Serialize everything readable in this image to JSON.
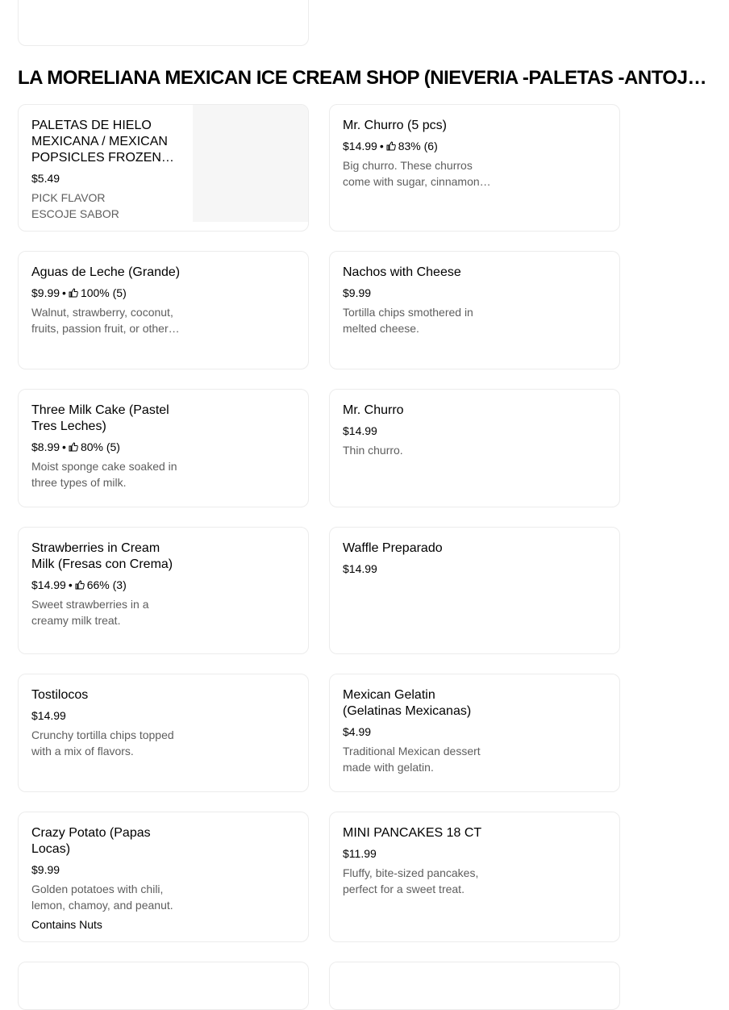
{
  "section": {
    "title": "LA MORELIANA MEXICAN ICE CREAM SHOP (NIEVERIA -PALETAS -ANTOJOS -MEXICAN SNACKS)"
  },
  "items": [
    {
      "name": "PALETAS DE HIELO MEXICANA / MEXICAN POPSICLES FROZEN( PALETAS)",
      "price": "$5.49",
      "description_lines": [
        "PICK FLAVOR",
        "ESCOJE SABOR"
      ],
      "has_image": true
    },
    {
      "name": "Mr. Churro (5 pcs)",
      "price": "$14.99",
      "rating": "83% (6)",
      "description": "Big churro. These churros come with sugar, cinnamon and your choice of filling."
    },
    {
      "name": "Aguas de Leche (Grande)",
      "price": "$9.99",
      "rating": "100% (5)",
      "description": "Walnut, strawberry, coconut, fruits, passion fruit, or other flavors available."
    },
    {
      "name": "Nachos with Cheese",
      "price": "$9.99",
      "description": "Tortilla chips smothered in melted cheese."
    },
    {
      "name": "Three Milk Cake (Pastel Tres Leches)",
      "price": "$8.99",
      "rating": "80% (5)",
      "description": "Moist sponge cake soaked in three types of milk."
    },
    {
      "name": "Mr. Churro",
      "price": "$14.99",
      "description": "Thin churro."
    },
    {
      "name": "Strawberries in Cream Milk (Fresas con Crema)",
      "price": "$14.99",
      "rating": "66% (3)",
      "description": "Sweet strawberries in a creamy milk treat."
    },
    {
      "name": "Waffle Preparado",
      "price": "$14.99"
    },
    {
      "name": "Tostilocos",
      "price": "$14.99",
      "description": "Crunchy tortilla chips topped with a mix of flavors."
    },
    {
      "name": "Mexican Gelatin (Gelatinas Mexicanas)",
      "price": "$4.99",
      "description": "Traditional Mexican dessert made with gelatin."
    },
    {
      "name": "Crazy Potato (Papas Locas)",
      "price": "$9.99",
      "description": "Golden potatoes with chili, lemon, chamoy, and peanut.",
      "tag": "Contains Nuts"
    },
    {
      "name": "MINI PANCAKES 18 CT",
      "price": "$11.99",
      "description": "Fluffy, bite-sized pancakes, perfect for a sweet treat."
    }
  ],
  "icons": {
    "rating": "thumbs-up-icon"
  },
  "colors": {
    "muted_text": "#5e5e5e",
    "card_border": "#ececec",
    "image_placeholder": "#f6f6f6"
  }
}
